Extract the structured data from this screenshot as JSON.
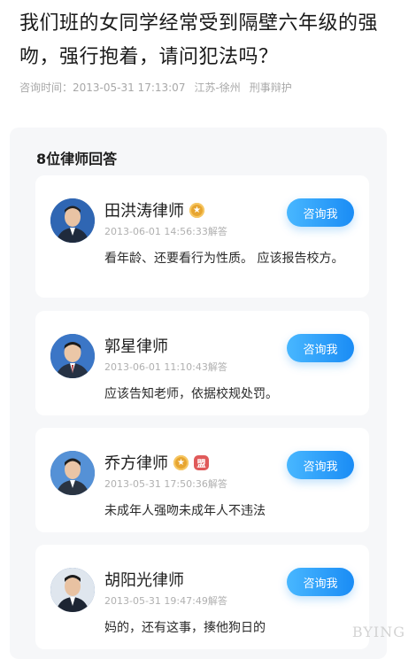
{
  "question": {
    "title": "我们班的女同学经常受到隔壁六年级的强吻，强行抱着，请问犯法吗？",
    "consult_time": "咨询时间：2013-05-31 17:13:07",
    "location": "江苏-徐州",
    "category": "刑事辩护"
  },
  "answers_header": "8位律师回答",
  "answers": [
    {
      "name": "田洪涛律师",
      "badges": [
        "gold-medal-icon"
      ],
      "time": "2013-06-01 14:56:33解答",
      "text": "看年龄、还要看行为性质。 应该报告校方。",
      "button": "咨询我"
    },
    {
      "name": "郭星律师",
      "badges": [],
      "time": "2013-06-01 11:10:43解答",
      "text": "应该告知老师，依据校规处罚。",
      "button": "咨询我"
    },
    {
      "name": "乔方律师",
      "badges": [
        "gold-medal-icon",
        "red-alliance-icon"
      ],
      "time": "2013-05-31 17:50:36解答",
      "text": "未成年人强吻未成年人不违法",
      "button": "咨询我"
    },
    {
      "name": "胡阳光律师",
      "badges": [],
      "time": "2013-05-31 19:47:49解答",
      "text": "妈的，还有这事，揍他狗日的",
      "button": "咨询我"
    }
  ],
  "watermark": "BYING",
  "colors": {
    "accent": "#1a8cf5",
    "panel_bg": "#f6f7f9",
    "meta_text": "#a8a8a8"
  }
}
